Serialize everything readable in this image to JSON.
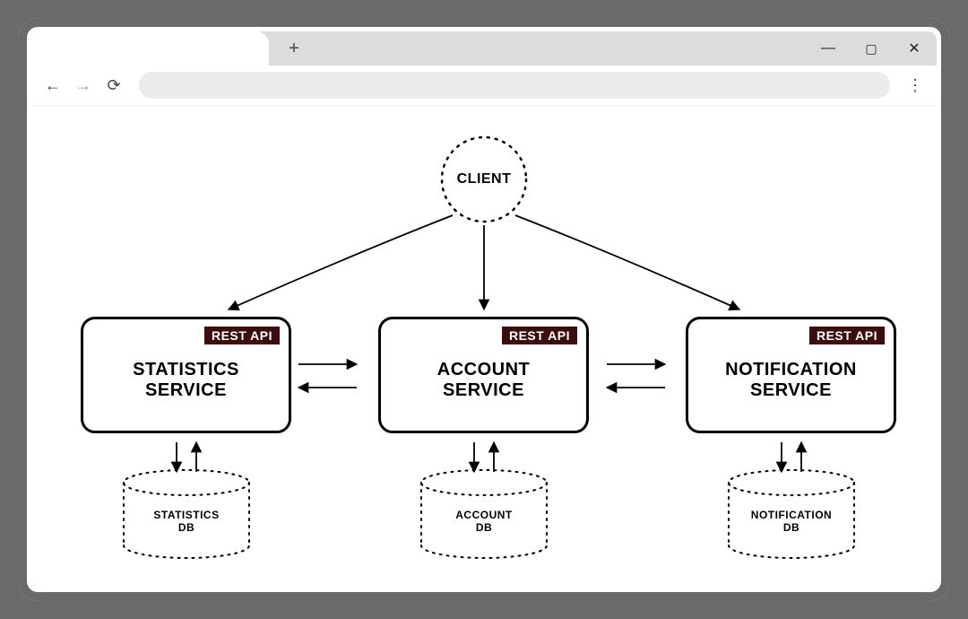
{
  "browser": {
    "new_tab_glyph": "+",
    "controls": {
      "minimize": "—",
      "maximize": "▢",
      "close": "✕"
    },
    "nav": {
      "back": "←",
      "forward": "→",
      "reload": "⟳",
      "menu": "⋮"
    }
  },
  "diagram": {
    "client_label": "CLIENT",
    "rest_badge": "REST API",
    "services": [
      {
        "id": "statistics",
        "title": "STATISTICS\nSERVICE",
        "db_label": "STATISTICS\nDB"
      },
      {
        "id": "account",
        "title": "ACCOUNT\nSERVICE",
        "db_label": "ACCOUNT\nDB"
      },
      {
        "id": "notification",
        "title": "NOTIFICATION\nSERVICE",
        "db_label": "NOTIFICATION\nDB"
      }
    ]
  }
}
